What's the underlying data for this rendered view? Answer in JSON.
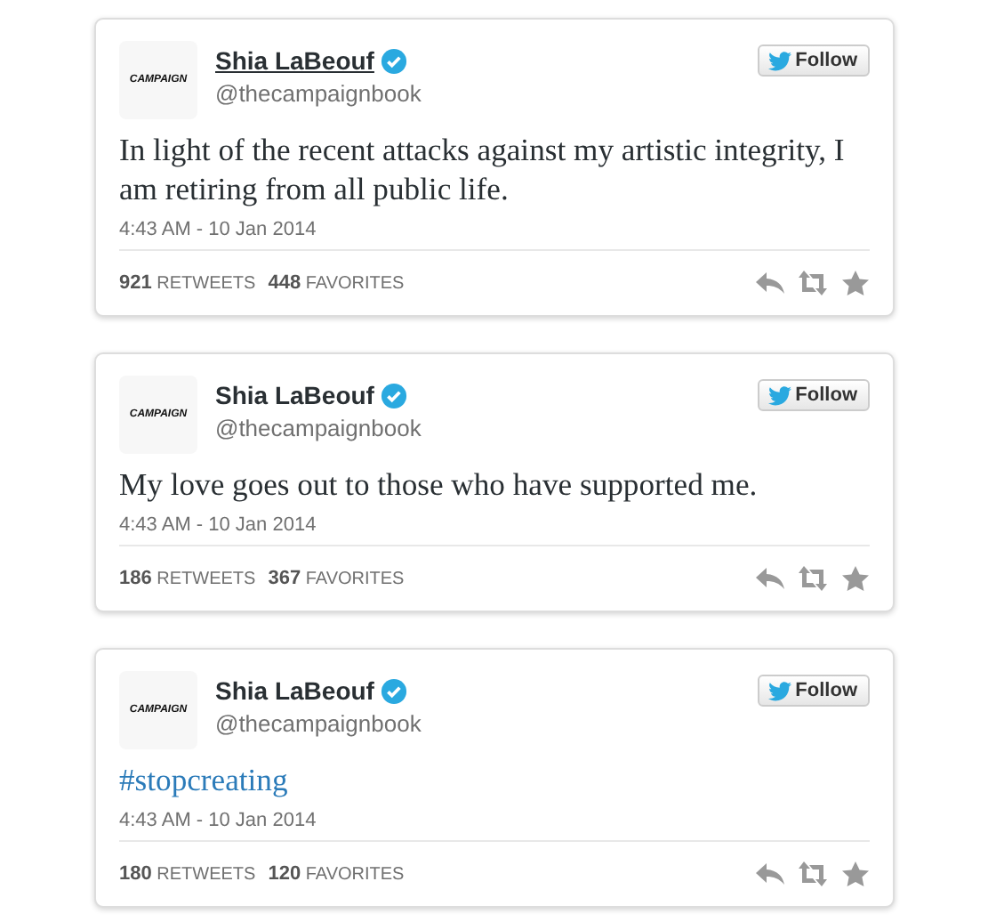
{
  "tweets": [
    {
      "avatar_text": "CAMPAIGN",
      "name": "Shia LaBeouf",
      "name_hovered": true,
      "verified": true,
      "handle": "@thecampaignbook",
      "follow_label": "Follow",
      "body": {
        "kind": "text",
        "text": "In light of the recent attacks against my artistic integrity, I am retiring from all public life."
      },
      "timestamp": "4:43 AM - 10 Jan 2014",
      "retweets": "**921** RETWEETS",
      "favorites": "**448** FAVORITES"
    },
    {
      "avatar_text": "CAMPAIGN",
      "name": "Shia LaBeouf",
      "name_hovered": false,
      "verified": true,
      "handle": "@thecampaignbook",
      "follow_label": "Follow",
      "body": {
        "kind": "text",
        "text": "My love goes out to those who have supported me."
      },
      "timestamp": "4:43 AM - 10 Jan 2014",
      "retweets": "**186** RETWEETS",
      "favorites": "**367** FAVORITES"
    },
    {
      "avatar_text": "CAMPAIGN",
      "name": "Shia LaBeouf",
      "name_hovered": false,
      "verified": true,
      "handle": "@thecampaignbook",
      "follow_label": "Follow",
      "body": {
        "kind": "hashtag",
        "text": "#stopcreating"
      },
      "timestamp": "4:43 AM - 10 Jan 2014",
      "retweets": "**180** RETWEETS",
      "favorites": "**120** FAVORITES"
    }
  ]
}
